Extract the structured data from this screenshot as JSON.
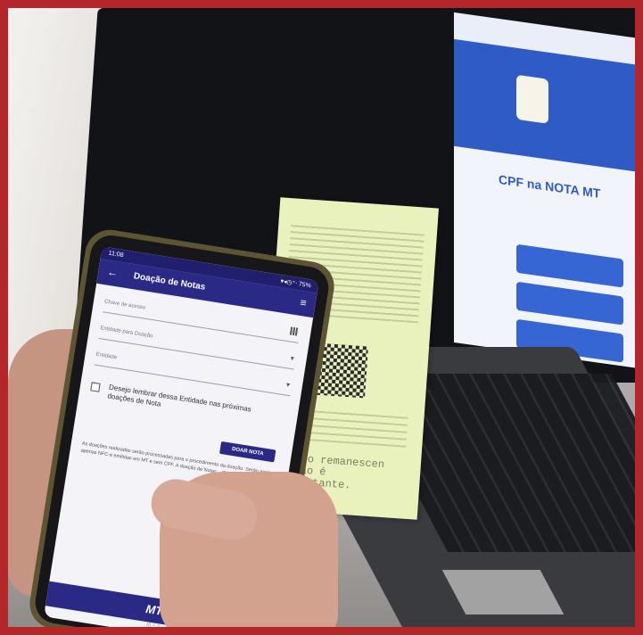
{
  "app": {
    "status_time": "11:08",
    "status_icons": "▾◂◷⁺ᐧ 75%",
    "back_symbol": "←",
    "title": "Doação de Notas",
    "menu_symbol": "≡",
    "fields": [
      {
        "label": "Chave de acesso"
      },
      {
        "label": "Entidade para Doação"
      },
      {
        "label": "Entidade"
      }
    ],
    "checkbox_label": "Desejo lembrar dessa Entidade nas próximas doações de Nota",
    "submit_label": "DOAR NOTA",
    "notes": "As doações realizadas serão processadas para o procedimento da doação. Serão aceitas apenas NFC-e emitidas em MT e sem CPF. A doação de Notas... Cópia e informações...",
    "brand": "MTI",
    "nav_symbols": "|||   ○   <"
  },
  "receipt": {
    "message": "Doe o remanescen\nintão é\nimportante."
  },
  "laptop": {
    "site_heading": "CPF na NOTA MT"
  }
}
